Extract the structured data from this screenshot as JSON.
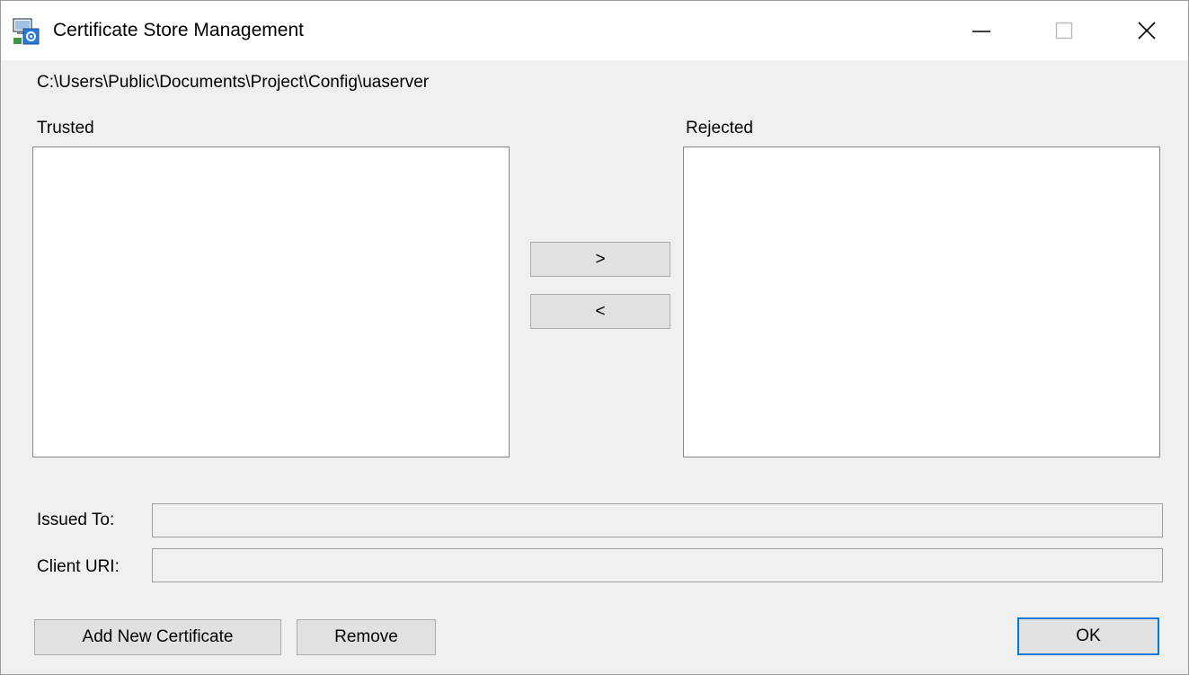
{
  "window": {
    "title": "Certificate Store Management",
    "minimize_glyph": "—",
    "maximize_glyph": "☐",
    "close_glyph": "✕"
  },
  "path": "C:\\Users\\Public\\Documents\\Project\\Config\\uaserver",
  "trusted": {
    "label": "Trusted",
    "items": []
  },
  "rejected": {
    "label": "Rejected",
    "items": []
  },
  "move_buttons": {
    "to_rejected": ">",
    "to_trusted": "<"
  },
  "details": {
    "issued_to_label": "Issued To:",
    "issued_to_value": "",
    "client_uri_label": "Client URI:",
    "client_uri_value": ""
  },
  "actions": {
    "add_label": "Add New Certificate",
    "remove_label": "Remove",
    "ok_label": "OK"
  },
  "colors": {
    "accent": "#0078d7",
    "dialog_bg": "#f0f0f0",
    "button_bg": "#e1e1e1"
  },
  "icons": {
    "app": "certificate-store-icon",
    "minimize": "minimize-icon",
    "maximize": "maximize-icon",
    "close": "close-icon"
  }
}
